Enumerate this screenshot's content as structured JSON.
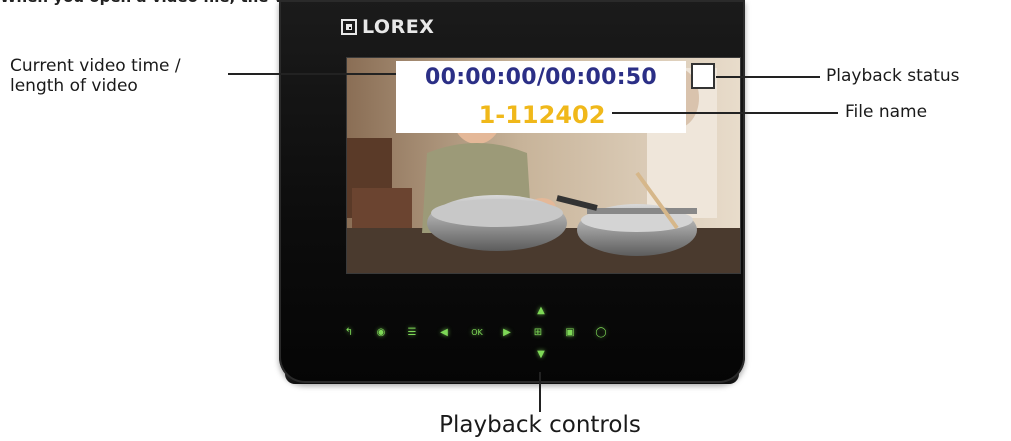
{
  "top_caption": "When you open a video file, the video will playback.",
  "device": {
    "brand": "LOREX"
  },
  "overlay": {
    "time": "00:00:00/00:00:50",
    "file_name": "1-112402"
  },
  "callouts": {
    "time_label_line1": "Current video time /",
    "time_label_line2": "length of video",
    "status_label": "Playback status",
    "file_label": "File name",
    "controls_label": "Playback controls"
  },
  "buttons": [
    {
      "name": "back-icon",
      "glyph": "↰"
    },
    {
      "name": "record-icon",
      "glyph": "◉"
    },
    {
      "name": "menu-icon",
      "glyph": "☰"
    },
    {
      "name": "left-arrow-icon",
      "glyph": "◀"
    },
    {
      "name": "ok-button",
      "glyph": "OK"
    },
    {
      "name": "right-arrow-icon",
      "glyph": "▶"
    },
    {
      "name": "quad-view-icon",
      "glyph": "⊞"
    },
    {
      "name": "zoom-icon",
      "glyph": "▣"
    },
    {
      "name": "speech-icon",
      "glyph": "◯"
    }
  ],
  "nav_up": {
    "glyph": "▲"
  },
  "nav_down": {
    "glyph": "▼"
  },
  "colors": {
    "time_color": "#2b2f86",
    "file_color": "#f0b81a",
    "button_glow": "#7ed957"
  }
}
